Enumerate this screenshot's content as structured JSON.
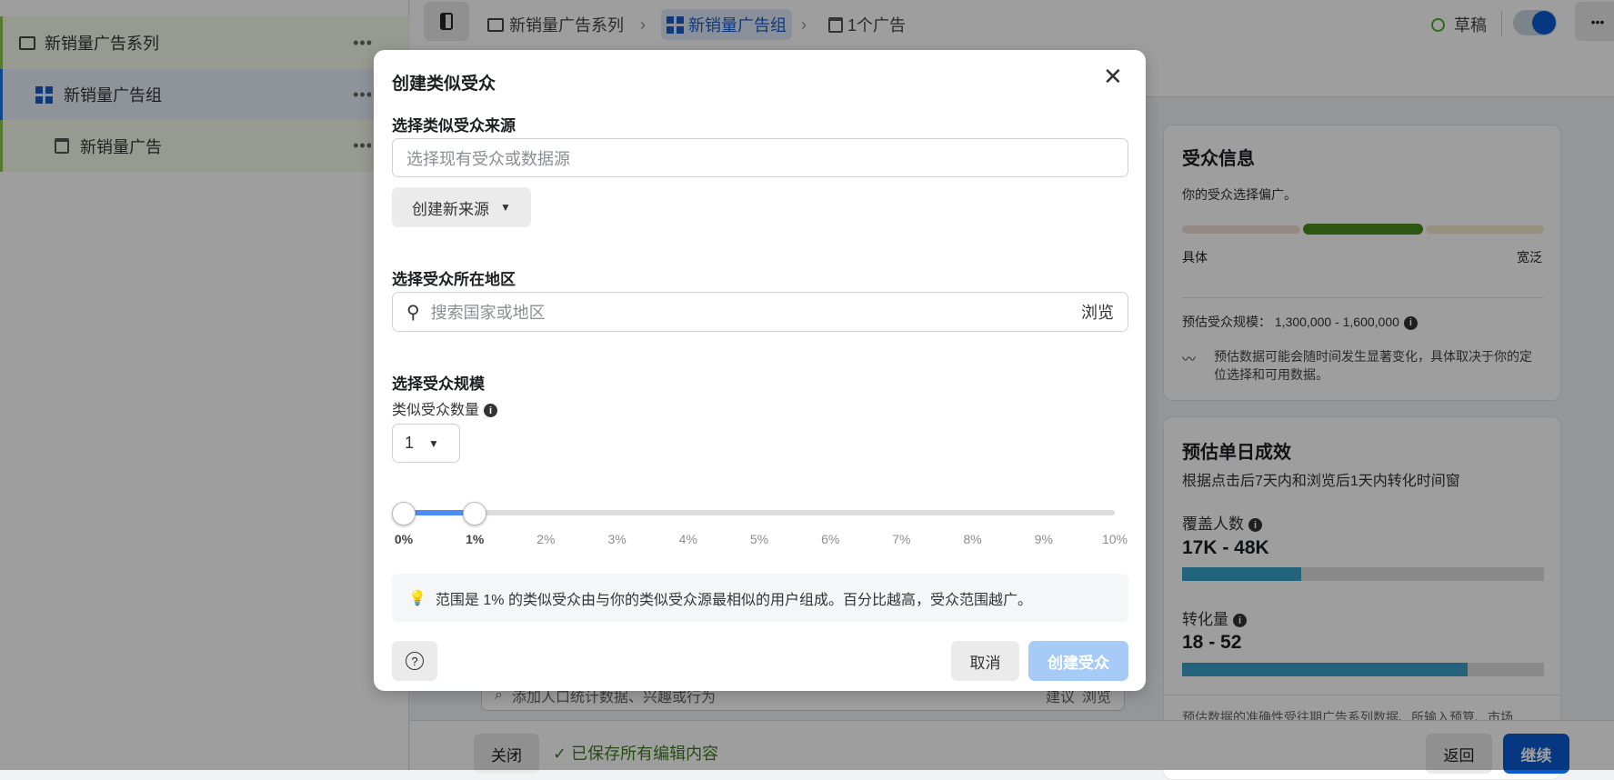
{
  "sidebar": {
    "items": [
      {
        "label": "新销量广告系列",
        "icon": "folder-icon"
      },
      {
        "label": "新销量广告组",
        "icon": "grid-icon"
      },
      {
        "label": "新销量广告",
        "icon": "ad-icon"
      }
    ],
    "more": "•••"
  },
  "topbar": {
    "breadcrumbs": [
      "新销量广告系列",
      "新销量广告组",
      "1个广告"
    ],
    "status": "草稿",
    "more": "•••",
    "toggle_on": true
  },
  "audience_card": {
    "title": "受众信息",
    "desc": "你的受众选择偏广。",
    "left_label": "具体",
    "right_label": "宽泛",
    "size_label": "预估受众规模：",
    "size_value": "1,300,000 - 1,600,000",
    "note": "预估数据可能会随时间发生显著变化，具体取决于你的定位选择和可用数据。"
  },
  "results_card": {
    "title": "预估单日成效",
    "subtitle": "根据点击后7天内和浏览后1天内转化时间窗",
    "reach_label": "覆盖人数",
    "reach_value": "17K - 48K",
    "reach_fill": 0.33,
    "conv_label": "转化量",
    "conv_value": "18 - 52",
    "conv_fill": 0.79,
    "footnote": "预估数据的准确性受往期广告系列数据、所输入预算、市场"
  },
  "background": {
    "search_placeholder": "添加人口统计数据、兴趣或行为",
    "suggest": "建议",
    "browse": "浏览"
  },
  "footer": {
    "close": "关闭",
    "saved": "已保存所有编辑内容",
    "back": "返回",
    "continue": "继续"
  },
  "modal": {
    "title": "创建类似受众",
    "source_label": "选择类似受众来源",
    "source_placeholder": "选择现有受众或数据源",
    "create_source": "创建新来源",
    "location_label": "选择受众所在地区",
    "location_placeholder": "搜索国家或地区",
    "browse": "浏览",
    "size_label": "选择受众规模",
    "count_label": "类似受众数量",
    "count_value": "1",
    "slider": {
      "min_percent": 0,
      "max_percent": 1,
      "ticks": [
        "0%",
        "1%",
        "2%",
        "3%",
        "4%",
        "5%",
        "6%",
        "7%",
        "8%",
        "9%",
        "10%"
      ]
    },
    "hint": "范围是 1% 的类似受众由与你的类似受众源最相似的用户组成。百分比越高，受众范围越广。",
    "cancel": "取消",
    "create": "创建受众"
  },
  "colors": {
    "accent": "#0a5bd0",
    "slider": "#4a8ef0",
    "create_disabled": "#a6cbf7",
    "green": "#4a8c1c",
    "bar": "#3aa0c8"
  }
}
